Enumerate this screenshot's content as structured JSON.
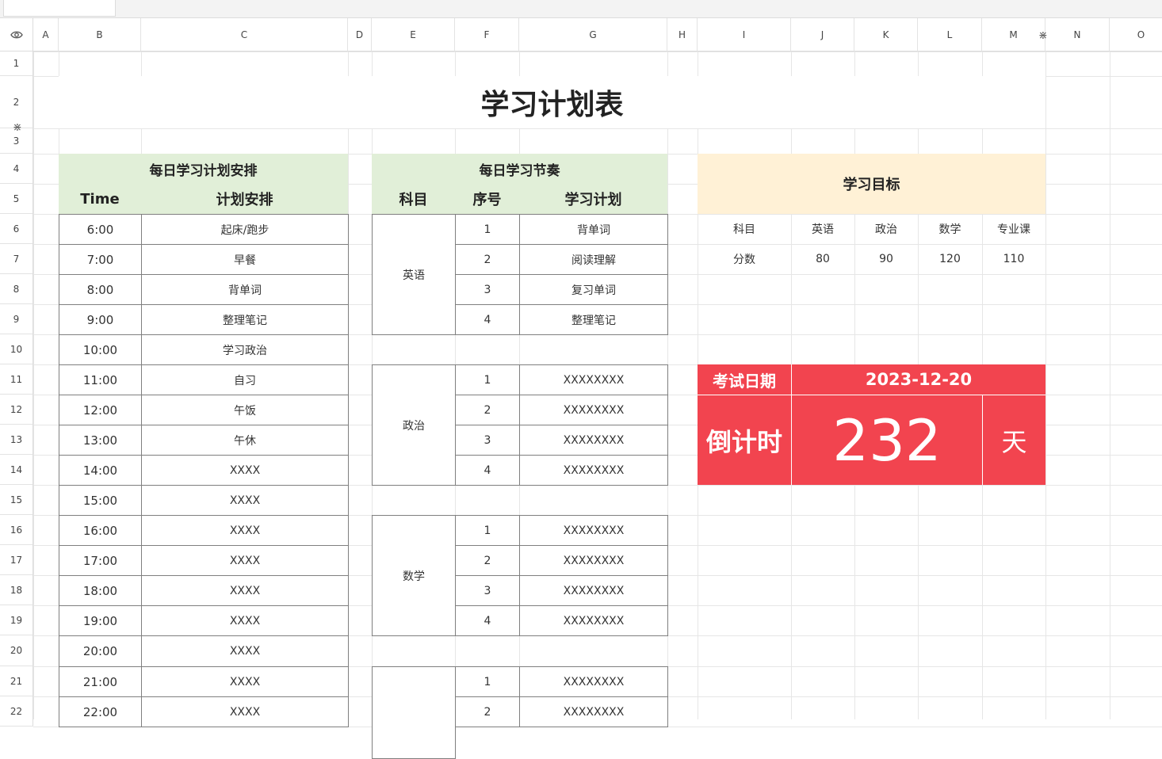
{
  "columns": [
    "A",
    "B",
    "C",
    "D",
    "E",
    "F",
    "G",
    "H",
    "I",
    "J",
    "K",
    "L",
    "M",
    "N",
    "O"
  ],
  "rows": [
    "1",
    "2",
    "3",
    "4",
    "5",
    "6",
    "7",
    "8",
    "9",
    "10",
    "11",
    "12",
    "13",
    "14",
    "15",
    "16",
    "17",
    "18",
    "19",
    "20",
    "21",
    "22"
  ],
  "icons": {
    "visibility": "eye-icon",
    "resize": "resize-handle-icon"
  },
  "title": "学习计划表",
  "daily": {
    "header": "每日学习计划安排",
    "time_label": "Time",
    "plan_label": "计划安排",
    "rows": [
      {
        "time": "6:00",
        "plan": "起床/跑步"
      },
      {
        "time": "7:00",
        "plan": "早餐"
      },
      {
        "time": "8:00",
        "plan": "背单词"
      },
      {
        "time": "9:00",
        "plan": "整理笔记"
      },
      {
        "time": "10:00",
        "plan": "学习政治"
      },
      {
        "time": "11:00",
        "plan": "自习"
      },
      {
        "time": "12:00",
        "plan": "午饭"
      },
      {
        "time": "13:00",
        "plan": "午休"
      },
      {
        "time": "14:00",
        "plan": "XXXX"
      },
      {
        "time": "15:00",
        "plan": "XXXX"
      },
      {
        "time": "16:00",
        "plan": "XXXX"
      },
      {
        "time": "17:00",
        "plan": "XXXX"
      },
      {
        "time": "18:00",
        "plan": "XXXX"
      },
      {
        "time": "19:00",
        "plan": "XXXX"
      },
      {
        "time": "20:00",
        "plan": "XXXX"
      },
      {
        "time": "21:00",
        "plan": "XXXX"
      },
      {
        "time": "22:00",
        "plan": "XXXX"
      }
    ]
  },
  "rhythm": {
    "header": "每日学习节奏",
    "subject_label": "科目",
    "seq_label": "序号",
    "plan_label": "学习计划",
    "groups": [
      {
        "subject": "英语",
        "items": [
          {
            "no": "1",
            "plan": "背单词"
          },
          {
            "no": "2",
            "plan": "阅读理解"
          },
          {
            "no": "3",
            "plan": "复习单词"
          },
          {
            "no": "4",
            "plan": "整理笔记"
          }
        ]
      },
      {
        "subject": "政治",
        "items": [
          {
            "no": "1",
            "plan": "XXXXXXXX"
          },
          {
            "no": "2",
            "plan": "XXXXXXXX"
          },
          {
            "no": "3",
            "plan": "XXXXXXXX"
          },
          {
            "no": "4",
            "plan": "XXXXXXXX"
          }
        ]
      },
      {
        "subject": "数学",
        "items": [
          {
            "no": "1",
            "plan": "XXXXXXXX"
          },
          {
            "no": "2",
            "plan": "XXXXXXXX"
          },
          {
            "no": "3",
            "plan": "XXXXXXXX"
          },
          {
            "no": "4",
            "plan": "XXXXXXXX"
          }
        ]
      },
      {
        "subject": "",
        "items": [
          {
            "no": "1",
            "plan": "XXXXXXXX"
          },
          {
            "no": "2",
            "plan": "XXXXXXXX"
          }
        ]
      }
    ]
  },
  "goals": {
    "header": "学习目标",
    "subject_label": "科目",
    "score_label": "分数",
    "subjects": [
      "英语",
      "政治",
      "数学",
      "专业课"
    ],
    "scores": [
      "80",
      "90",
      "120",
      "110"
    ]
  },
  "exam": {
    "date_label": "考试日期",
    "date": "2023-12-20",
    "countdown_label": "倒计时",
    "days": "232",
    "unit": "天"
  },
  "colors": {
    "green": "#e1efd8",
    "yellow": "#fff1d6",
    "red": "#f2444f"
  }
}
